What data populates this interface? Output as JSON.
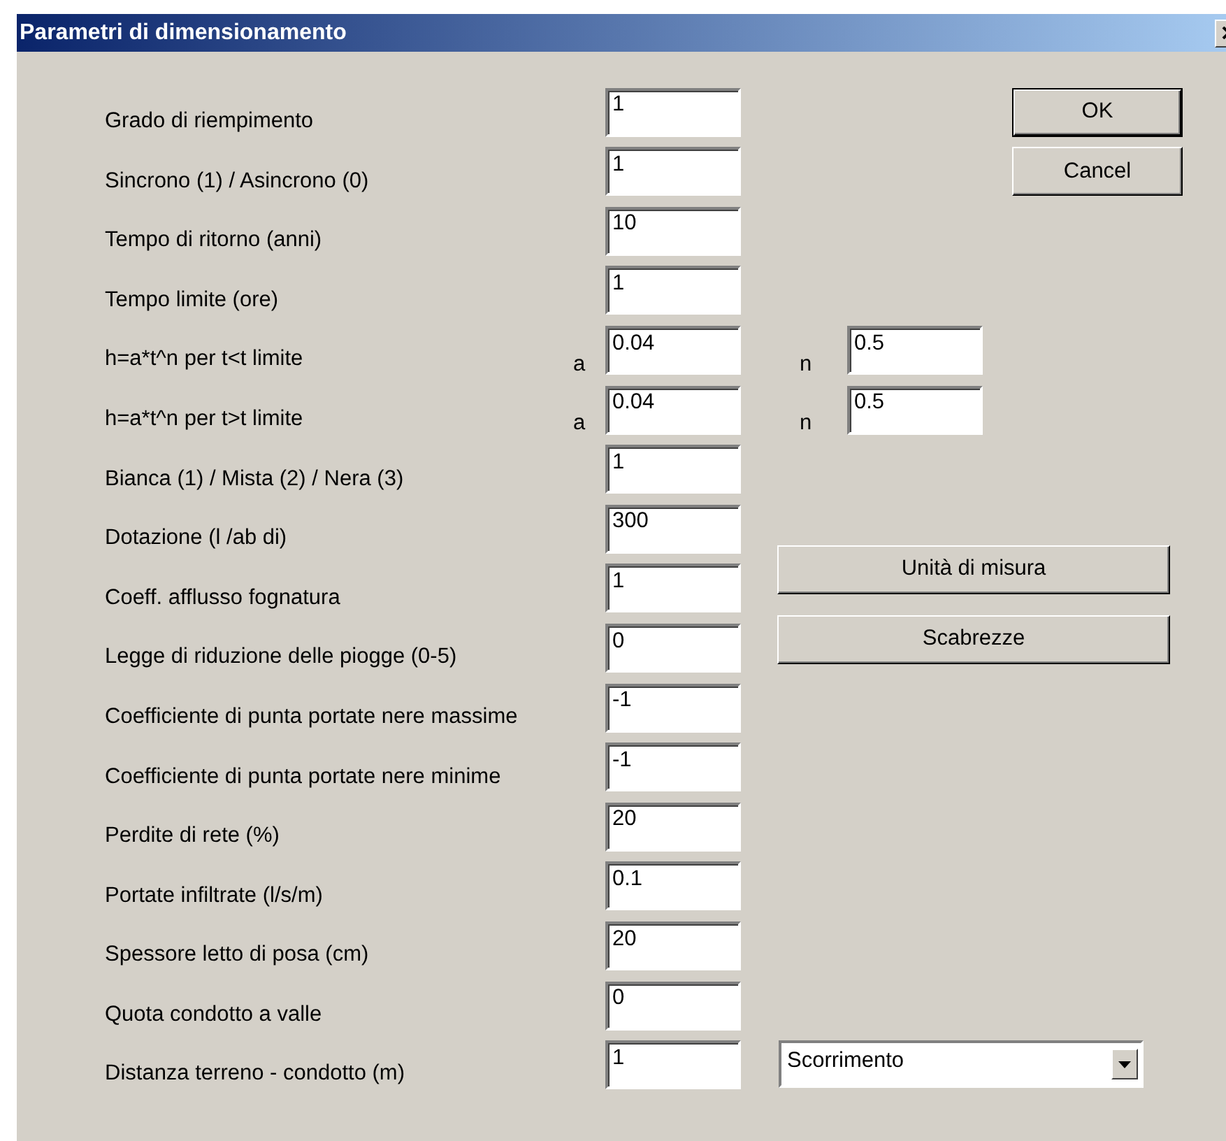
{
  "window": {
    "title": "Parametri di dimensionamento"
  },
  "fields": [
    {
      "kind": "single",
      "label": "Grado di riempimento",
      "value": "1"
    },
    {
      "kind": "single",
      "label": "Sincrono (1) / Asincrono (0)",
      "value": "1"
    },
    {
      "kind": "single",
      "label": "Tempo di ritorno (anni)",
      "value": "10"
    },
    {
      "kind": "single",
      "label": "Tempo limite (ore)",
      "value": "1"
    },
    {
      "kind": "pair",
      "label": "h=a*t^n per t<t limite",
      "a_label": "a",
      "value": "0.04",
      "n_label": "n",
      "n_value": "0.5"
    },
    {
      "kind": "pair",
      "label": "h=a*t^n per t>t limite",
      "a_label": "a",
      "value": "0.04",
      "n_label": "n",
      "n_value": "0.5"
    },
    {
      "kind": "single",
      "label": "Bianca (1) / Mista (2) / Nera (3)",
      "value": "1"
    },
    {
      "kind": "single",
      "label": "Dotazione (l /ab di)",
      "value": "300"
    },
    {
      "kind": "single",
      "label": "Coeff. afflusso fognatura",
      "value": "1"
    },
    {
      "kind": "single",
      "label": "Legge di riduzione delle piogge (0-5)",
      "value": "0"
    },
    {
      "kind": "single",
      "label": "Coefficiente di punta portate nere massime",
      "value": "-1"
    },
    {
      "kind": "single",
      "label": "Coefficiente di punta portate nere minime",
      "value": "-1"
    },
    {
      "kind": "single",
      "label": "Perdite di rete (%)",
      "value": "20"
    },
    {
      "kind": "single",
      "label": "Portate infiltrate (l/s/m)",
      "value": "0.1"
    },
    {
      "kind": "single",
      "label": "Spessore letto di posa (cm)",
      "value": "20"
    },
    {
      "kind": "single",
      "label": "Quota condotto a valle",
      "value": "0"
    },
    {
      "kind": "single",
      "label": "Distanza terreno - condotto (m)",
      "value": "1"
    }
  ],
  "dialog_buttons": [
    "OK",
    "Cancel"
  ],
  "side_buttons": [
    "Unità di misura",
    "Scabrezze"
  ],
  "mode_select": {
    "value": "Scorrimento"
  }
}
